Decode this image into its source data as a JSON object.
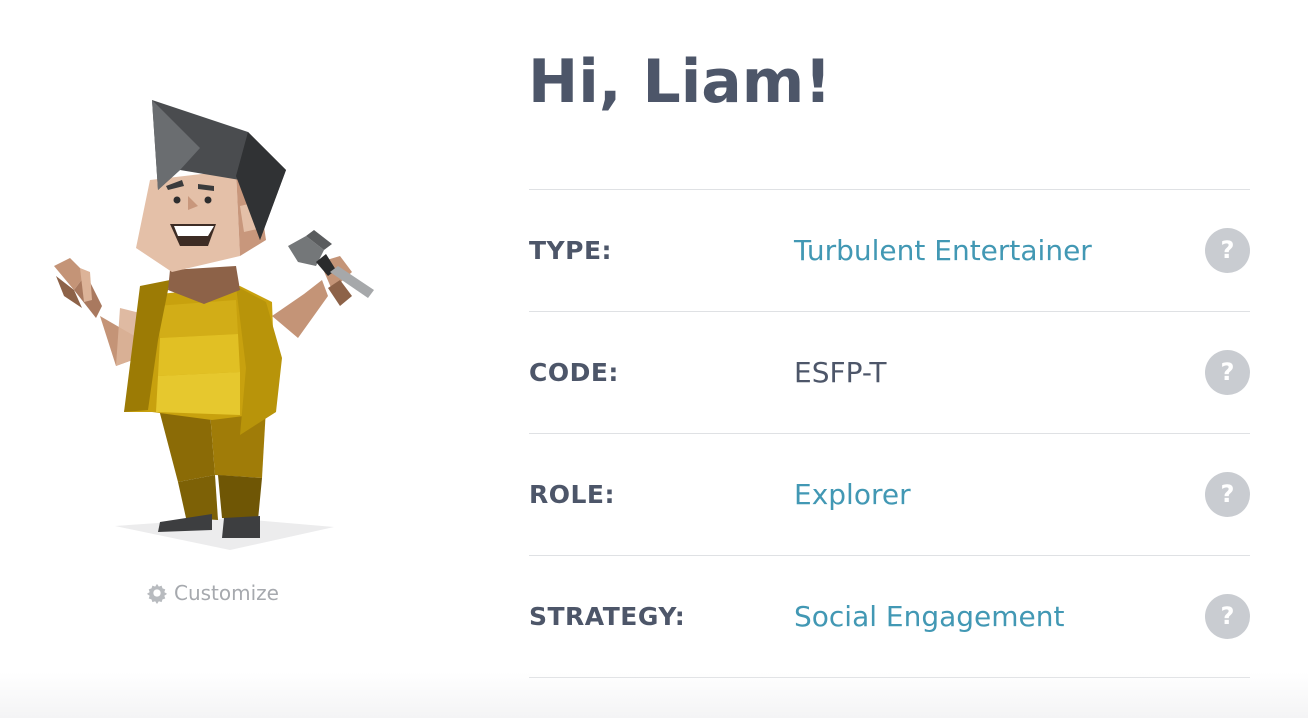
{
  "greeting": "Hi, Liam!",
  "avatar": {
    "icon": "entertainer-avatar-illustration",
    "customize_label": "Customize",
    "customize_icon": "gear-icon"
  },
  "profile_rows": [
    {
      "label": "TYPE:",
      "value": "Turbulent Entertainer",
      "value_is_link": true,
      "help_icon": "?"
    },
    {
      "label": "CODE:",
      "value": "ESFP-T",
      "value_is_link": false,
      "help_icon": "?"
    },
    {
      "label": "ROLE:",
      "value": "Explorer",
      "value_is_link": true,
      "help_icon": "?"
    },
    {
      "label": "STRATEGY:",
      "value": "Social Engagement",
      "value_is_link": true,
      "help_icon": "?"
    }
  ],
  "colors": {
    "heading": "#4d5669",
    "link": "#4298b4",
    "help_bg": "#c9ccd1",
    "divider": "#dfe1e4",
    "muted": "#a6a9ae"
  }
}
